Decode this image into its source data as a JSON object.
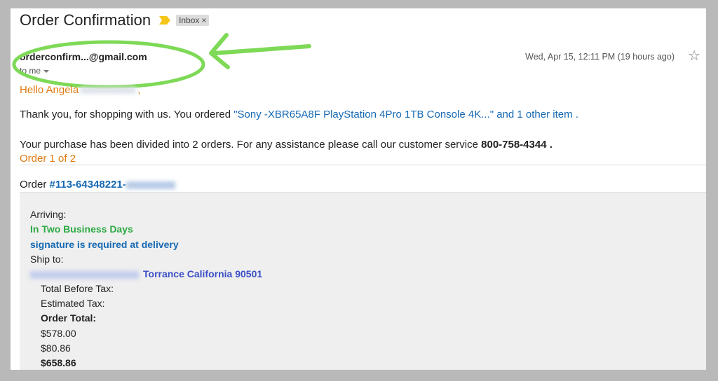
{
  "email": {
    "subject": "Order Confirmation",
    "inbox_label": "Inbox",
    "inbox_close": "×",
    "sender": "orderconfirm...@gmail.com",
    "to": "to me",
    "date": "Wed, Apr 15, 12:11 PM (19 hours ago)",
    "star": "☆"
  },
  "body": {
    "greeting_prefix": "Hello Angela",
    "greeting_suffix": ",",
    "thanks_prefix": "Thank you, for shopping with us. You ordered ",
    "product_link": "\"Sony -XBR65A8F PlayStation 4Pro 1TB Console 4K...\" and 1 other item .",
    "divided_text": "Your purchase has been divided into 2 orders. For any assistance please call our customer service ",
    "phone": "800-758-4344 .",
    "order_of": "Order 1 of 2",
    "order_label": "Order ",
    "order_number": "#113-64348221-"
  },
  "details": {
    "arriving_label": "Arriving:",
    "arriving_value": "In Two Business Days",
    "signature_note": "signature is required at delivery",
    "ship_to_label": "Ship to:",
    "ship_to_city": "Torrance California 90501",
    "total_before_tax_label": "Total Before Tax:",
    "estimated_tax_label": "Estimated Tax:",
    "order_total_label": "Order Total:",
    "total_before_tax": "$578.00",
    "estimated_tax": "$80.86",
    "order_total": "$658.86"
  },
  "colors": {
    "annotation_green": "#7ed957",
    "link_blue": "#1669b3",
    "greeting_orange": "#e07a10",
    "arriving_green": "#2eaa44"
  }
}
